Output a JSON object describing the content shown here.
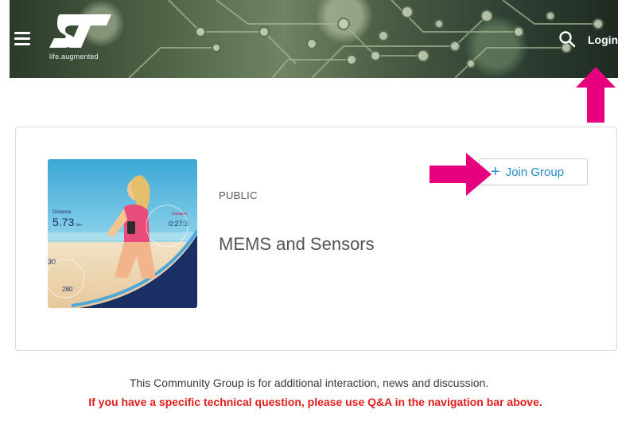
{
  "header": {
    "brand_tagline": "life.augmented",
    "login_label": "Login",
    "icons": {
      "menu": "hamburger-menu-icon",
      "search": "search-icon",
      "logo": "st-logo"
    }
  },
  "group": {
    "visibility": "PUBLIC",
    "title": "MEMS and Sensors",
    "join_label": "Join Group",
    "join_icon": "plus-icon",
    "image": {
      "distance_label": "Distance",
      "distance_value": "5.73",
      "distance_unit": "km",
      "duration_label": "Duration",
      "duration_value": "0:27:3",
      "hr_value": "30",
      "cal_value": "280"
    }
  },
  "description": "This Community Group is for additional interaction, news and discussion.",
  "notice": "If you have a specific technical question, please use Q&A in the navigation bar above.",
  "colors": {
    "accent": "#2a8ccf",
    "notice_red": "#e01e1e",
    "annotation_magenta": "#e6007e"
  }
}
